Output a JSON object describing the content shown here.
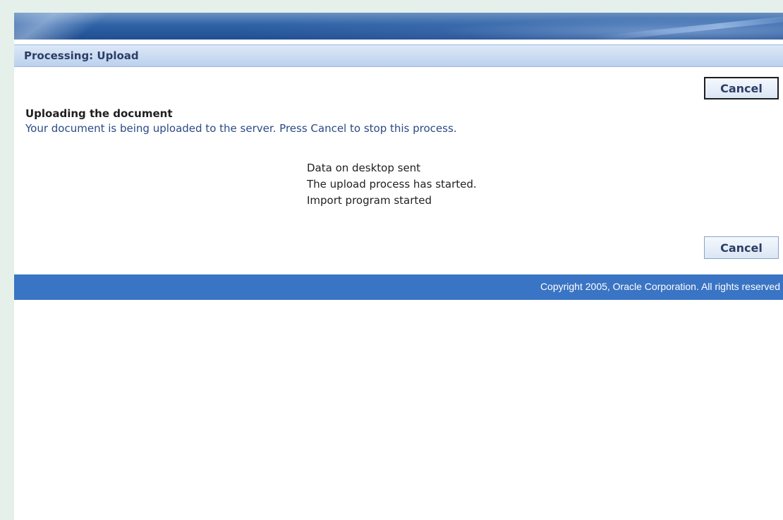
{
  "header": {
    "page_title": "Processing: Upload"
  },
  "buttons": {
    "cancel_top_label": "Cancel",
    "cancel_bottom_label": "Cancel"
  },
  "content": {
    "heading": "Uploading the document",
    "instruction": "Your document is being uploaded to the server. Press Cancel to stop this process.",
    "status_messages": [
      "Data on desktop sent",
      "The upload process has started.",
      "Import program started"
    ]
  },
  "footer": {
    "copyright": "Copyright 2005, Oracle Corporation. All rights reserved"
  },
  "colors": {
    "page_background": "#e6f0ea",
    "branding_blue": "#2f62a6",
    "title_bar": "#bcd1ee",
    "footer_blue": "#3a74c4",
    "instruction_text": "#2b4a86"
  }
}
